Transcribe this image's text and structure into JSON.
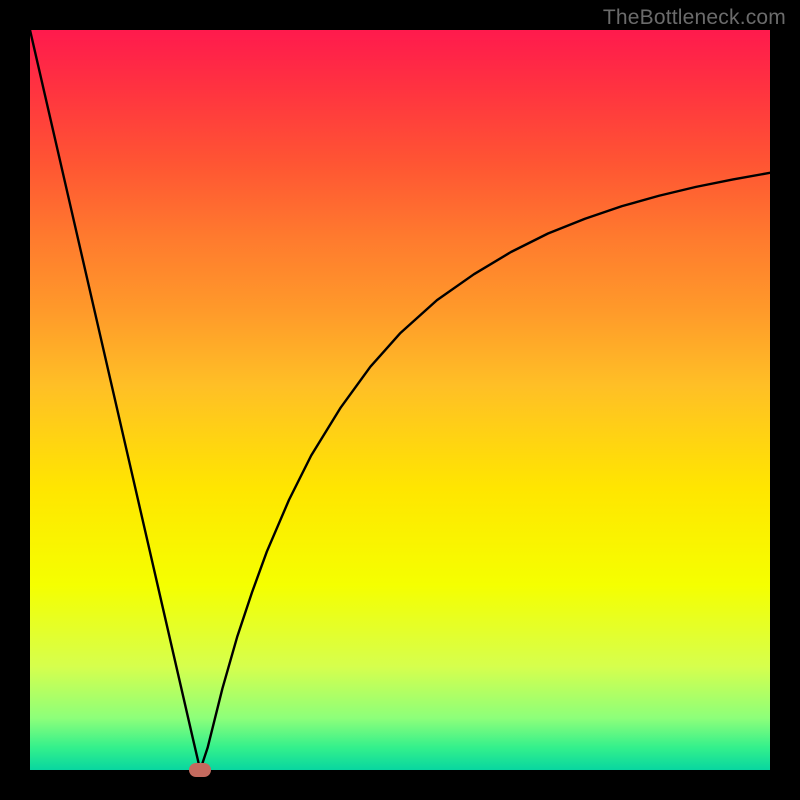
{
  "chart_data": {
    "type": "line",
    "title": "",
    "xlabel": "",
    "ylabel": "",
    "xlim": [
      0,
      100
    ],
    "ylim": [
      0,
      100
    ],
    "series": [
      {
        "name": "curve",
        "x": [
          0,
          2,
          4,
          6,
          8,
          10,
          12,
          14,
          16,
          18,
          20,
          22,
          23,
          24,
          25,
          26,
          28,
          30,
          32,
          35,
          38,
          42,
          46,
          50,
          55,
          60,
          65,
          70,
          75,
          80,
          85,
          90,
          95,
          100
        ],
        "y": [
          100,
          91.3,
          82.6,
          73.9,
          65.2,
          56.5,
          47.8,
          39.1,
          30.4,
          21.7,
          13.0,
          4.3,
          0,
          3.0,
          7.0,
          11.0,
          18.0,
          24.0,
          29.5,
          36.5,
          42.5,
          49.0,
          54.5,
          59.0,
          63.5,
          67.0,
          70.0,
          72.5,
          74.5,
          76.2,
          77.6,
          78.8,
          79.8,
          80.7
        ]
      }
    ],
    "marker": {
      "x": 23,
      "y": 0
    },
    "watermark": "TheBottleneck.com",
    "background_gradient": {
      "top": "#ff1a4d",
      "bottom": "#08d6a0"
    },
    "curve_color": "#000000",
    "marker_color": "#c46a5e"
  }
}
